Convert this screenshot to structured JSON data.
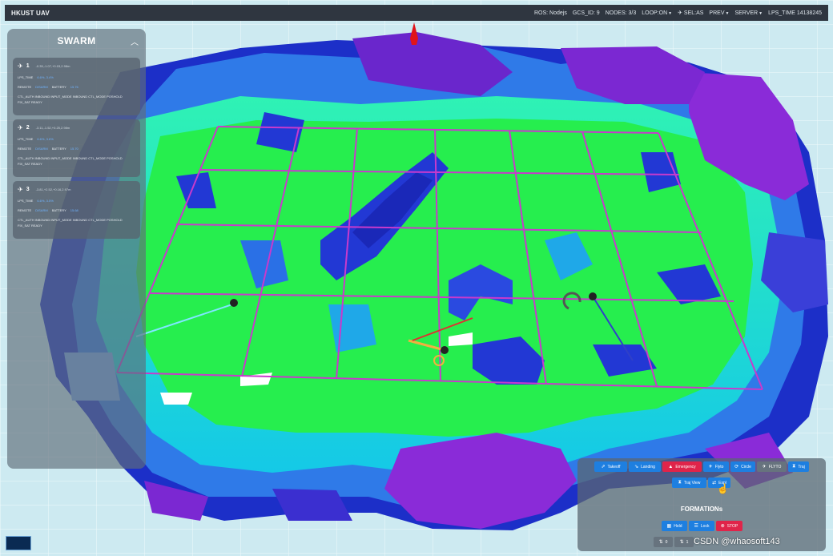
{
  "header": {
    "app_title": "HKUST UAV",
    "ros_status": "ROS: Nodejs",
    "gcs_id": "GCS_ID: 9",
    "nodes": "NODES: 3/3",
    "loop": "LOOP:ON",
    "selected": "SEL:AS",
    "prev": "PREV",
    "server": "SERVER",
    "lps_time": "LPS_TIME 14138245"
  },
  "swarm": {
    "title": "SWARM",
    "uavs": [
      {
        "id": "1",
        "pos": "-0.35,-1.07,+0.03,2.98m",
        "lps_time": "LPS_TIME",
        "lps_val": "6.6%, 3.4%",
        "remote_label": "REMOTE",
        "remote": "DISARM",
        "battery": "BATTERY",
        "bat_val": "15.76"
      },
      {
        "id": "2",
        "pos": "-3.11,-1.52,+0.25,2.98m",
        "lps_time": "LPS_TIME",
        "lps_val": "6.6%, 3.6%",
        "remote_label": "REMOTE",
        "remote": "DISARM",
        "battery": "BATTERY",
        "bat_val": "15.70"
      },
      {
        "id": "3",
        "pos": "-3.81,+2.52,+0.16,2.97m",
        "lps_time": "LPS_TIME",
        "lps_val": "6.6%, 3.5%",
        "remote_label": "REMOTE",
        "remote": "DISARM",
        "battery": "BATTERY",
        "bat_val": "15.68"
      }
    ],
    "flags": "CTL_AUTH   INBOUND   INPUT_MODE   INBOUND   CTL_MODE   POSHOLD",
    "flags2": "FIX_SAT   READY"
  },
  "controls": {
    "takeoff": "Takeoff",
    "landing": "Landing",
    "emergency": "Emergency",
    "flyto": "Flyto",
    "circle": "Circle",
    "flyto2": "FLYTO",
    "traj": "Traj",
    "traj_view": "Traj View",
    "expl": "Expl",
    "formations_title": "FORMATIONs",
    "hold": "Hold",
    "lock": "Lock",
    "stop": "STOP",
    "small1": "0",
    "small2": "1"
  },
  "watermark": "CSDN @whaosoft143",
  "colors": {
    "accent": "#1e7fe0",
    "danger": "#e0244a",
    "grid": "#c83acc",
    "voxel_green": "#25f04d",
    "voxel_blue": "#2238d4",
    "voxel_purple": "#8b2ad6"
  }
}
